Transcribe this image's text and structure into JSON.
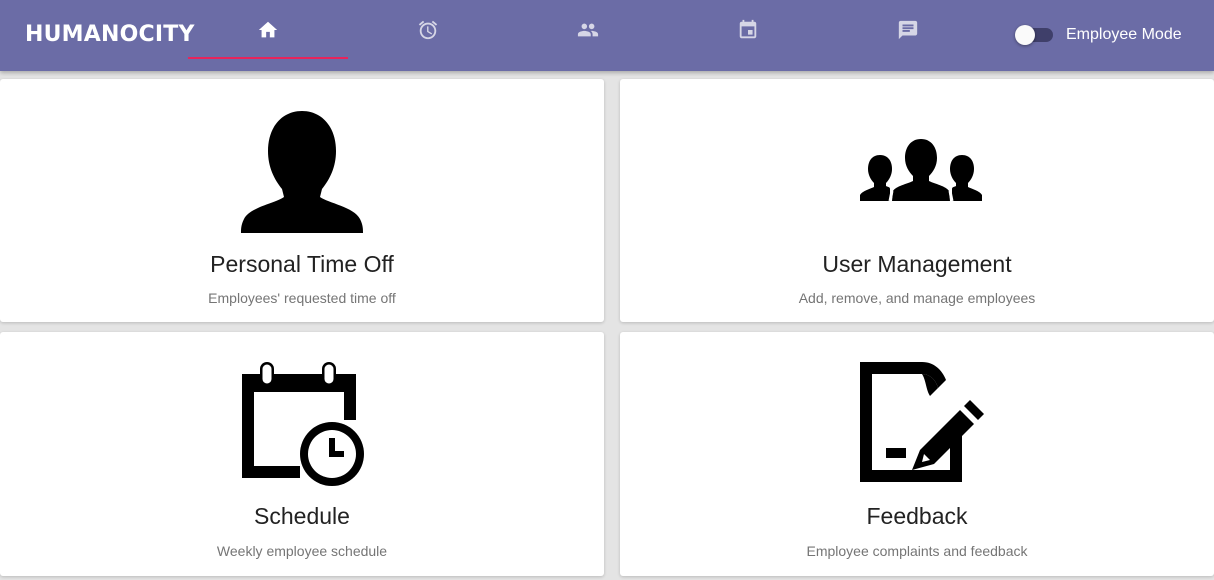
{
  "header": {
    "brand": "HUMANOCITY",
    "tabs": [
      {
        "icon": "home-icon",
        "active": true
      },
      {
        "icon": "alarm-icon",
        "active": false
      },
      {
        "icon": "people-icon",
        "active": false
      },
      {
        "icon": "calendar-icon",
        "active": false
      },
      {
        "icon": "message-icon",
        "active": false
      }
    ],
    "indicator_color": "#e8245b",
    "background_color": "#6b6ca6",
    "mode_toggle": {
      "label": "Employee Mode",
      "checked": false
    }
  },
  "cards": [
    {
      "icon": "person-icon",
      "title": "Personal Time Off",
      "description": "Employees' requested time off"
    },
    {
      "icon": "group-icon",
      "title": "User Management",
      "description": "Add, remove, and manage employees"
    },
    {
      "icon": "calendar-clock-icon",
      "title": "Schedule",
      "description": "Weekly employee schedule"
    },
    {
      "icon": "document-edit-icon",
      "title": "Feedback",
      "description": "Employee complaints and feedback"
    }
  ]
}
